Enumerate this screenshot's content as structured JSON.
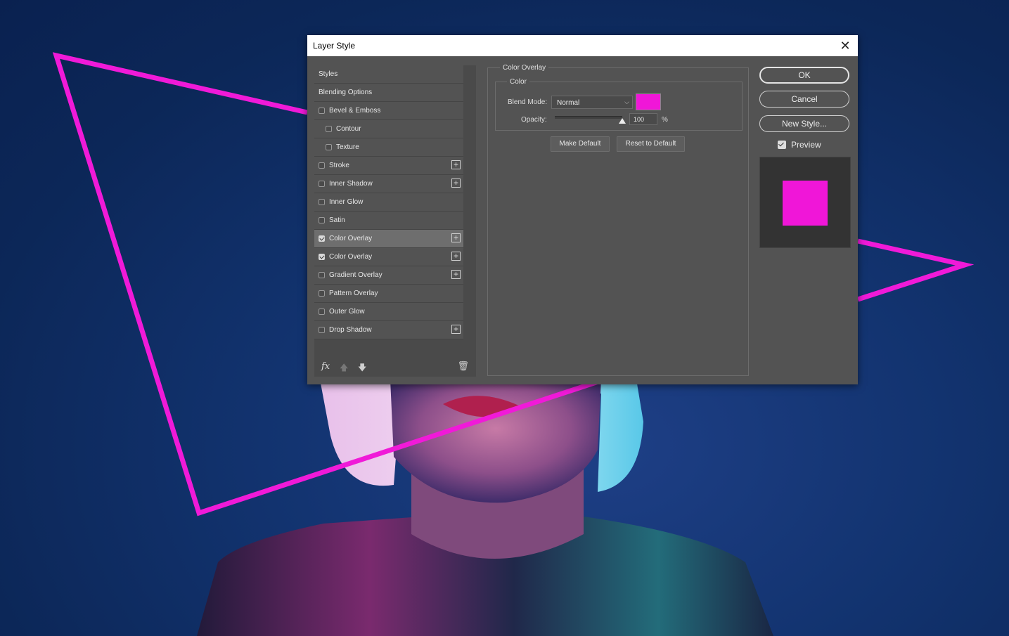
{
  "dialog": {
    "title": "Layer Style",
    "close_icon": "close-icon"
  },
  "styles_panel": {
    "items": [
      {
        "label": "Styles",
        "checkbox": false,
        "checked": false,
        "indent": false,
        "plus": false,
        "selected": false
      },
      {
        "label": "Blending Options",
        "checkbox": false,
        "checked": false,
        "indent": false,
        "plus": false,
        "selected": false
      },
      {
        "label": "Bevel & Emboss",
        "checkbox": true,
        "checked": false,
        "indent": false,
        "plus": false,
        "selected": false
      },
      {
        "label": "Contour",
        "checkbox": true,
        "checked": false,
        "indent": true,
        "plus": false,
        "selected": false
      },
      {
        "label": "Texture",
        "checkbox": true,
        "checked": false,
        "indent": true,
        "plus": false,
        "selected": false
      },
      {
        "label": "Stroke",
        "checkbox": true,
        "checked": false,
        "indent": false,
        "plus": true,
        "selected": false
      },
      {
        "label": "Inner Shadow",
        "checkbox": true,
        "checked": false,
        "indent": false,
        "plus": true,
        "selected": false
      },
      {
        "label": "Inner Glow",
        "checkbox": true,
        "checked": false,
        "indent": false,
        "plus": false,
        "selected": false
      },
      {
        "label": "Satin",
        "checkbox": true,
        "checked": false,
        "indent": false,
        "plus": false,
        "selected": false
      },
      {
        "label": "Color Overlay",
        "checkbox": true,
        "checked": true,
        "indent": false,
        "plus": true,
        "selected": true
      },
      {
        "label": "Color Overlay",
        "checkbox": true,
        "checked": true,
        "indent": false,
        "plus": true,
        "selected": false
      },
      {
        "label": "Gradient Overlay",
        "checkbox": true,
        "checked": false,
        "indent": false,
        "plus": true,
        "selected": false
      },
      {
        "label": "Pattern Overlay",
        "checkbox": true,
        "checked": false,
        "indent": false,
        "plus": false,
        "selected": false
      },
      {
        "label": "Outer Glow",
        "checkbox": true,
        "checked": false,
        "indent": false,
        "plus": false,
        "selected": false
      },
      {
        "label": "Drop Shadow",
        "checkbox": true,
        "checked": false,
        "indent": false,
        "plus": true,
        "selected": false
      }
    ],
    "footer": {
      "fx_label": "fx",
      "move_up_icon": "arrow-up-icon",
      "move_down_icon": "arrow-down-icon",
      "delete_icon": "trash-icon"
    }
  },
  "color_overlay": {
    "section_title": "Color Overlay",
    "group_title": "Color",
    "blend_mode_label": "Blend Mode:",
    "blend_mode_value": "Normal",
    "color": "#f016d8",
    "opacity_label": "Opacity:",
    "opacity_value": "100",
    "opacity_unit": "%",
    "opacity_fraction": 1.0,
    "make_default_label": "Make Default",
    "reset_default_label": "Reset to Default"
  },
  "actions": {
    "ok_label": "OK",
    "cancel_label": "Cancel",
    "new_style_label": "New Style...",
    "preview_label": "Preview",
    "preview_checked": true,
    "preview_color": "#f016d8"
  },
  "background": {
    "shape_color": "#f01ad8",
    "base_color": "#0f2c66"
  }
}
